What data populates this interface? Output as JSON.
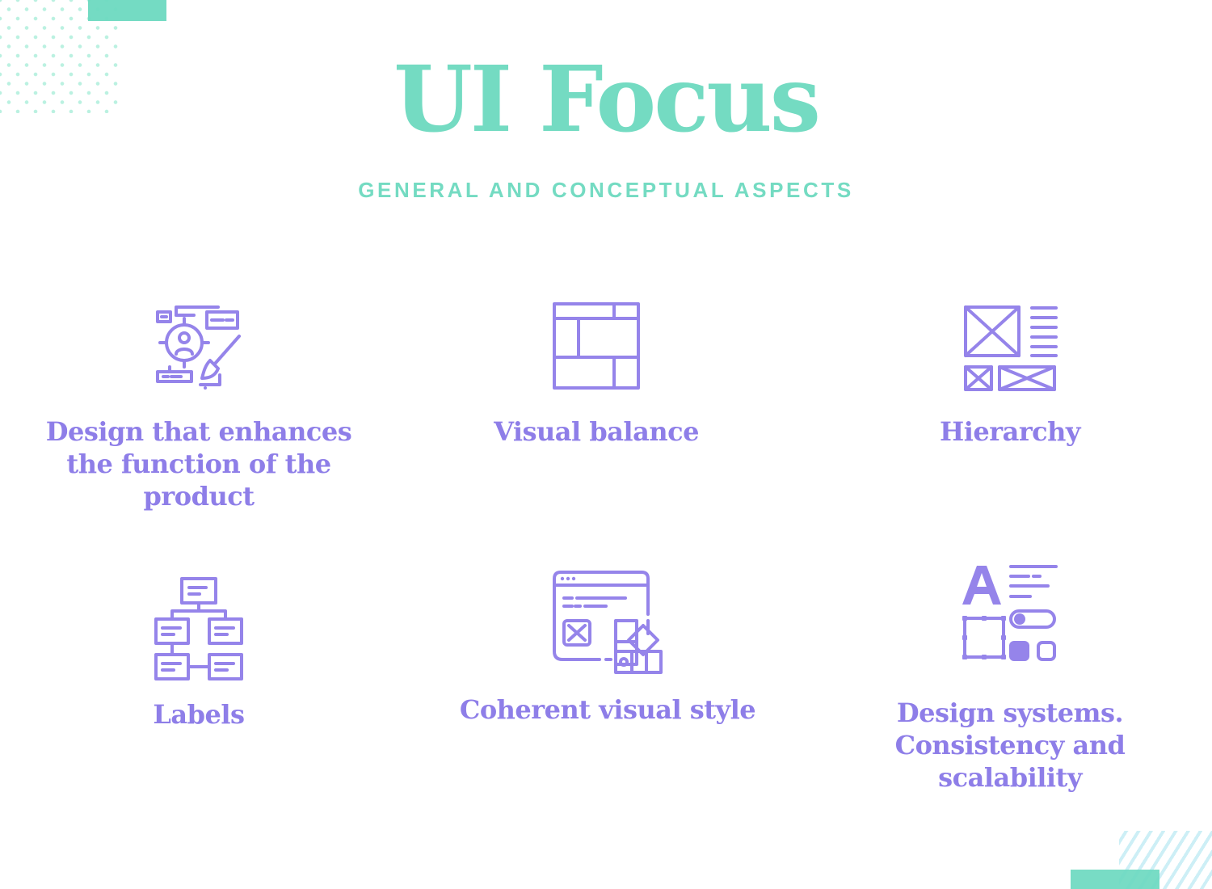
{
  "header": {
    "title": "UI Focus",
    "subtitle": "GENERAL AND CONCEPTUAL ASPECTS"
  },
  "colors": {
    "accent_teal": "#74dbc2",
    "accent_purple": "#8e7ee8"
  },
  "cards": [
    {
      "icon": "design-target-brush-icon",
      "label": "Design that enhances the function of the product"
    },
    {
      "icon": "layout-grid-icon",
      "label": "Visual balance"
    },
    {
      "icon": "wireframe-hierarchy-icon",
      "label": "Hierarchy"
    },
    {
      "icon": "flowchart-labels-icon",
      "label": "Labels"
    },
    {
      "icon": "browser-color-swatch-icon",
      "label": "Coherent visual style"
    },
    {
      "icon": "design-system-components-icon",
      "label": "Design systems. Consistency and scalability"
    }
  ]
}
